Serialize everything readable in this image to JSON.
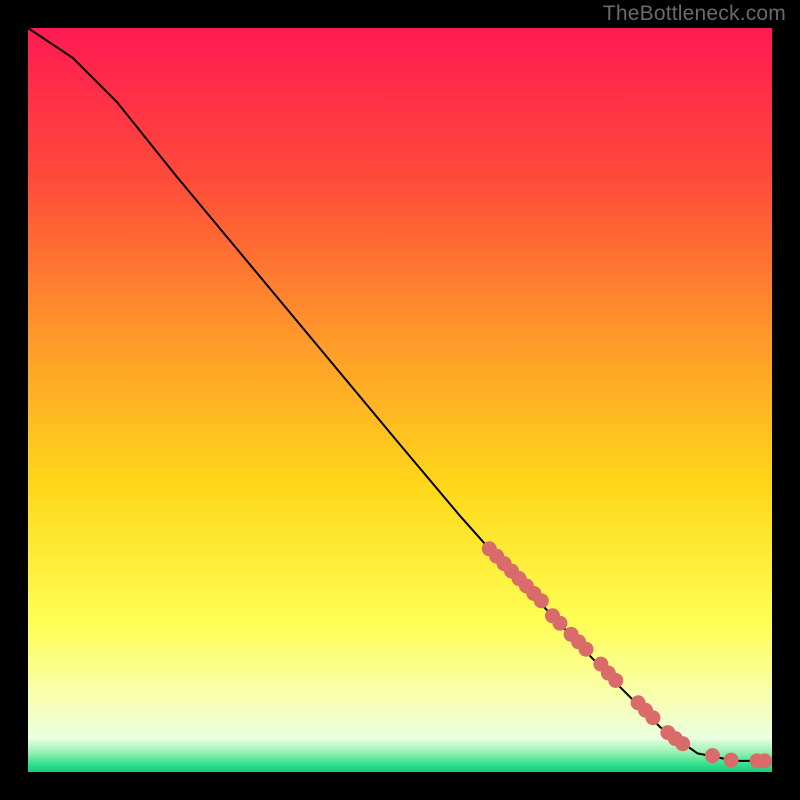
{
  "attribution": "TheBottleneck.com",
  "chart_data": {
    "type": "line",
    "title": "",
    "xlabel": "",
    "ylabel": "",
    "xlim": [
      0,
      100
    ],
    "ylim": [
      0,
      100
    ],
    "curve": [
      {
        "x": 0,
        "y": 100
      },
      {
        "x": 6,
        "y": 96
      },
      {
        "x": 12,
        "y": 90
      },
      {
        "x": 20,
        "y": 80
      },
      {
        "x": 30,
        "y": 68
      },
      {
        "x": 40,
        "y": 56
      },
      {
        "x": 50,
        "y": 44
      },
      {
        "x": 58,
        "y": 34.5
      },
      {
        "x": 62,
        "y": 30
      },
      {
        "x": 70,
        "y": 21.5
      },
      {
        "x": 78,
        "y": 13
      },
      {
        "x": 85,
        "y": 6
      },
      {
        "x": 90,
        "y": 2.5
      },
      {
        "x": 95,
        "y": 1.5
      },
      {
        "x": 100,
        "y": 1.5
      }
    ],
    "points": [
      {
        "x": 62,
        "y": 30
      },
      {
        "x": 63,
        "y": 29
      },
      {
        "x": 64,
        "y": 28
      },
      {
        "x": 65,
        "y": 27
      },
      {
        "x": 66,
        "y": 26
      },
      {
        "x": 67,
        "y": 25
      },
      {
        "x": 68,
        "y": 24
      },
      {
        "x": 69,
        "y": 23
      },
      {
        "x": 70.5,
        "y": 21
      },
      {
        "x": 71.5,
        "y": 20
      },
      {
        "x": 73,
        "y": 18.5
      },
      {
        "x": 74,
        "y": 17.5
      },
      {
        "x": 75,
        "y": 16.5
      },
      {
        "x": 77,
        "y": 14.5
      },
      {
        "x": 78,
        "y": 13.3
      },
      {
        "x": 79,
        "y": 12.3
      },
      {
        "x": 82,
        "y": 9.3
      },
      {
        "x": 83,
        "y": 8.3
      },
      {
        "x": 84,
        "y": 7.3
      },
      {
        "x": 86,
        "y": 5.3
      },
      {
        "x": 87,
        "y": 4.5
      },
      {
        "x": 88,
        "y": 3.8
      },
      {
        "x": 92,
        "y": 2.2
      },
      {
        "x": 94.5,
        "y": 1.6
      },
      {
        "x": 98,
        "y": 1.5
      },
      {
        "x": 99,
        "y": 1.5
      }
    ],
    "point_color": "#d96b6b",
    "curve_color": "#000000",
    "gradient_stops": [
      {
        "offset": 0.0,
        "color": "#ff1a52"
      },
      {
        "offset": 0.2,
        "color": "#ff4a3a"
      },
      {
        "offset": 0.42,
        "color": "#ff9a2a"
      },
      {
        "offset": 0.62,
        "color": "#ffd91a"
      },
      {
        "offset": 0.8,
        "color": "#ffff55"
      },
      {
        "offset": 0.9,
        "color": "#f8ffb0"
      },
      {
        "offset": 0.955,
        "color": "#eaffe0"
      },
      {
        "offset": 0.975,
        "color": "#8ff0b0"
      },
      {
        "offset": 0.99,
        "color": "#2fe08c"
      },
      {
        "offset": 1.0,
        "color": "#18c97a"
      }
    ]
  }
}
